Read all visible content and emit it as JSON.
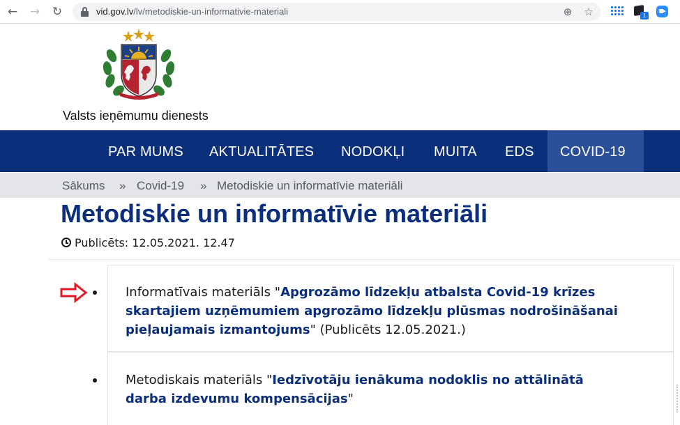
{
  "browser": {
    "url_host": "vid.gov.lv",
    "url_path": "/lv/metodiskie-un-informativie-materiali",
    "extension_badge": "1",
    "icons": [
      "back-icon",
      "forward-icon",
      "reload-icon",
      "lock-icon",
      "zoom-icon",
      "bookmark-star-icon",
      "apps-grid-icon",
      "extension-cube-icon",
      "zoom-app-icon"
    ]
  },
  "header": {
    "site_name": "Valsts ieņēmumu dienests"
  },
  "nav": {
    "items": [
      {
        "label": "PAR MUMS"
      },
      {
        "label": "AKTUALITĀTES"
      },
      {
        "label": "NODOKĻI"
      },
      {
        "label": "MUITA"
      },
      {
        "label": "EDS"
      },
      {
        "label": "COVID-19"
      }
    ],
    "active": "COVID-19",
    "bg_color": "#0b2f7a",
    "active_color": "#2b4f99"
  },
  "breadcrumb": {
    "items": [
      "Sākums",
      "Covid-19",
      "Metodiskie un informatīvie materiāli"
    ],
    "separator": "»"
  },
  "page": {
    "title": "Metodiskie un informatīvie materiāli",
    "published_label": "Publicēts: 12.05.2021. 12.47"
  },
  "items": [
    {
      "prefix": "Informatīvais materiāls \"",
      "link": "Apgrozāmo līdzekļu atbalsta Covid-19 krīzes skartajiem uzņēmumiem apgrozāmo līdzekļu plūsmas nodrošināšanai pieļaujamais izmantojums",
      "suffix": "\" (Publicēts 12.05.2021.)"
    },
    {
      "prefix": "Metodiskais materiāls \"",
      "link": "Iedzīvotāju ienākuma nodoklis no attālinātā darba izdevumu kompensācijas",
      "suffix": "\""
    }
  ],
  "annotation": {
    "arrow_color": "#e01b24",
    "arrow_icon": "red-outline-arrow-icon"
  }
}
